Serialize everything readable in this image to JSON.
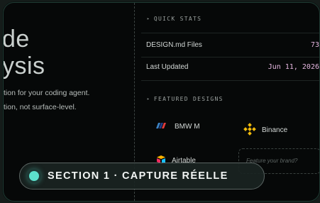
{
  "hero": {
    "title_line1": "de",
    "title_line2": "ysis",
    "subtitle_line1": "tion for your coding agent.",
    "subtitle_line2": "tion, not surface-level."
  },
  "quick_stats": {
    "label": "QUICK STATS",
    "rows": [
      {
        "label": "DESIGN.md Files",
        "value": "73"
      },
      {
        "label": "Last Updated",
        "value": "Jun 11, 2026"
      }
    ]
  },
  "featured_designs": {
    "label": "FEATURED DESIGNS",
    "items": [
      {
        "name": "BMW M",
        "icon": "bmw-m-logo-icon"
      },
      {
        "name": "Binance",
        "icon": "binance-logo-icon"
      },
      {
        "name": "Airtable",
        "icon": "airtable-logo-icon"
      }
    ],
    "feature_placeholder": "Feature your brand?"
  },
  "badge": {
    "text": "SECTION 1 · CAPTURE RÉELLE",
    "dot_color": "#5ce0cc"
  },
  "colors": {
    "accent_value": "#e5b7e0",
    "binance_yellow": "#f0b90b"
  }
}
